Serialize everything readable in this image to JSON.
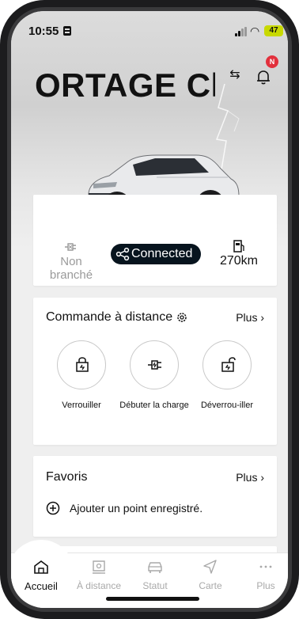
{
  "status_bar": {
    "time": "10:55",
    "battery_level": "47",
    "battery_color": "#c8d900"
  },
  "header": {
    "car_title": "ORTAGE Ch",
    "notification_badge": "N",
    "swap_icon": "swap-arrows-icon",
    "bell_icon": "bell-icon"
  },
  "vehicle_status": {
    "plug_status": "Non branché",
    "connection_status": "Connected",
    "range": "270km",
    "accent_dark": "#07141e"
  },
  "remote_control": {
    "title": "Commande à distance",
    "more_label": "Plus",
    "actions": [
      {
        "label": "Verrouiller",
        "icon": "lock-door-icon"
      },
      {
        "label": "Débuter la charge",
        "icon": "charge-plug-icon"
      },
      {
        "label": "Déverrou-iller",
        "icon": "unlock-door-icon"
      }
    ]
  },
  "favorites": {
    "title": "Favoris",
    "more_label": "Plus",
    "add_label": "Ajouter un point enregistré."
  },
  "tabs": [
    {
      "label": "Accueil",
      "icon": "home-icon",
      "active": true
    },
    {
      "label": "À distance",
      "icon": "remote-icon",
      "active": false
    },
    {
      "label": "Statut",
      "icon": "car-status-icon",
      "active": false
    },
    {
      "label": "Carte",
      "icon": "navigation-icon",
      "active": false
    },
    {
      "label": "Plus",
      "icon": "more-dots-icon",
      "active": false
    }
  ]
}
